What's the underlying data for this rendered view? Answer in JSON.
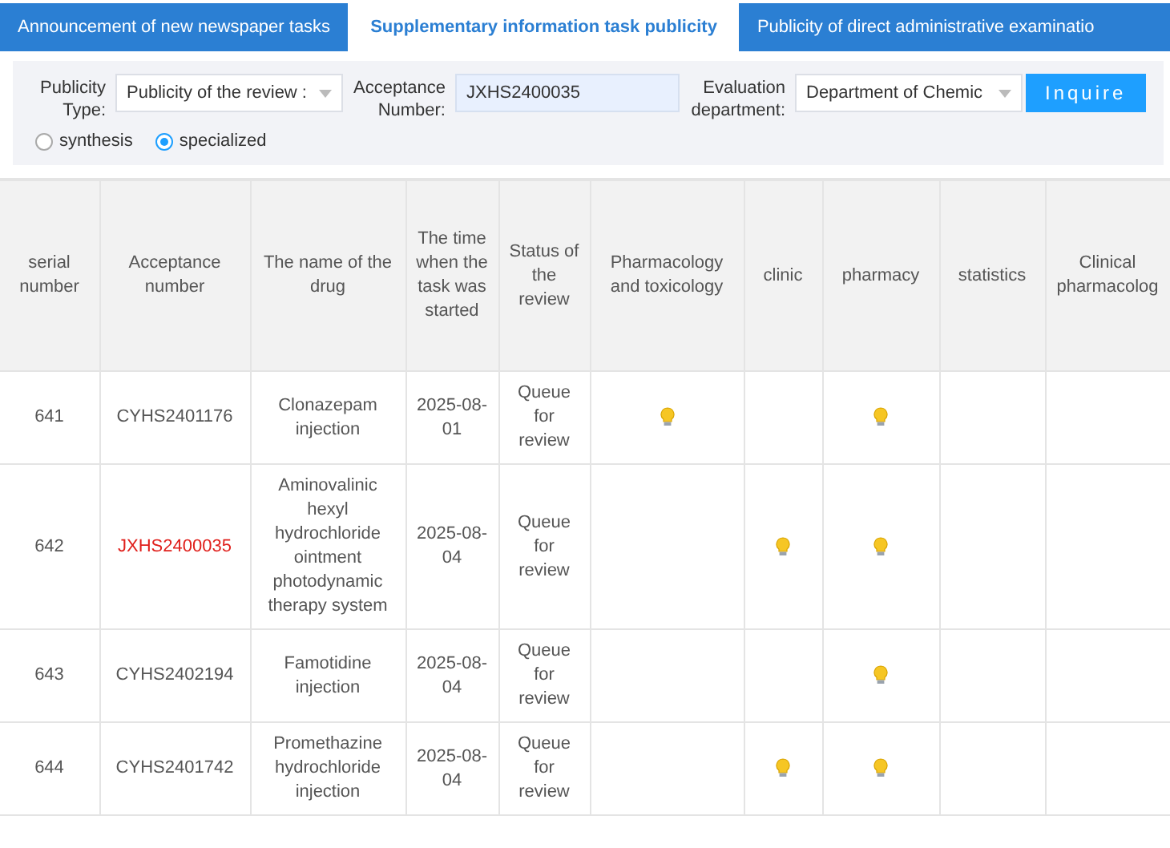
{
  "tabs": [
    {
      "label": "Announcement of new newspaper tasks",
      "selected": false
    },
    {
      "label": "Supplementary information task publicity",
      "selected": true
    },
    {
      "label": "Publicity of direct administrative examinatio",
      "selected": false
    }
  ],
  "filters": [
    {
      "kind": "select",
      "label": "Publicity Type:",
      "value": "Publicity of the review :"
    },
    {
      "kind": "input",
      "label": "Acceptance Number:",
      "value": "JXHS2400035"
    },
    {
      "kind": "select",
      "label": "Evaluation department:",
      "value": "Department of Chemic"
    }
  ],
  "inquire_button": "Inquire",
  "radios": [
    {
      "label": "synthesis",
      "selected": false
    },
    {
      "label": "specialized",
      "selected": true
    }
  ],
  "table": {
    "columns": [
      "serial number",
      "Acceptance number",
      "The name of the drug",
      "The time when the task was started",
      "Status of the review",
      "Pharmacology and toxicology",
      "clinic",
      "pharmacy",
      "statistics",
      "Clinical pharmacolog"
    ],
    "rows": [
      {
        "serial": "641",
        "acceptance": "CYHS2401176",
        "highlighted": false,
        "drug": "Clonazepam injection",
        "started": "2025-08-01",
        "status": "Queue for review",
        "flags": [
          true,
          false,
          true,
          false,
          false
        ]
      },
      {
        "serial": "642",
        "acceptance": "JXHS2400035",
        "highlighted": true,
        "drug": "Aminovalinic hexyl hydrochloride ointment photodynamic therapy system",
        "started": "2025-08-04",
        "status": "Queue for review",
        "flags": [
          false,
          true,
          true,
          false,
          false
        ]
      },
      {
        "serial": "643",
        "acceptance": "CYHS2402194",
        "highlighted": false,
        "drug": "Famotidine injection",
        "started": "2025-08-04",
        "status": "Queue for review",
        "flags": [
          false,
          false,
          true,
          false,
          false
        ]
      },
      {
        "serial": "644",
        "acceptance": "CYHS2401742",
        "highlighted": false,
        "drug": "Promethazine hydrochloride injection",
        "started": "2025-08-04",
        "status": "Queue for review",
        "flags": [
          false,
          true,
          true,
          false,
          false
        ]
      }
    ]
  }
}
